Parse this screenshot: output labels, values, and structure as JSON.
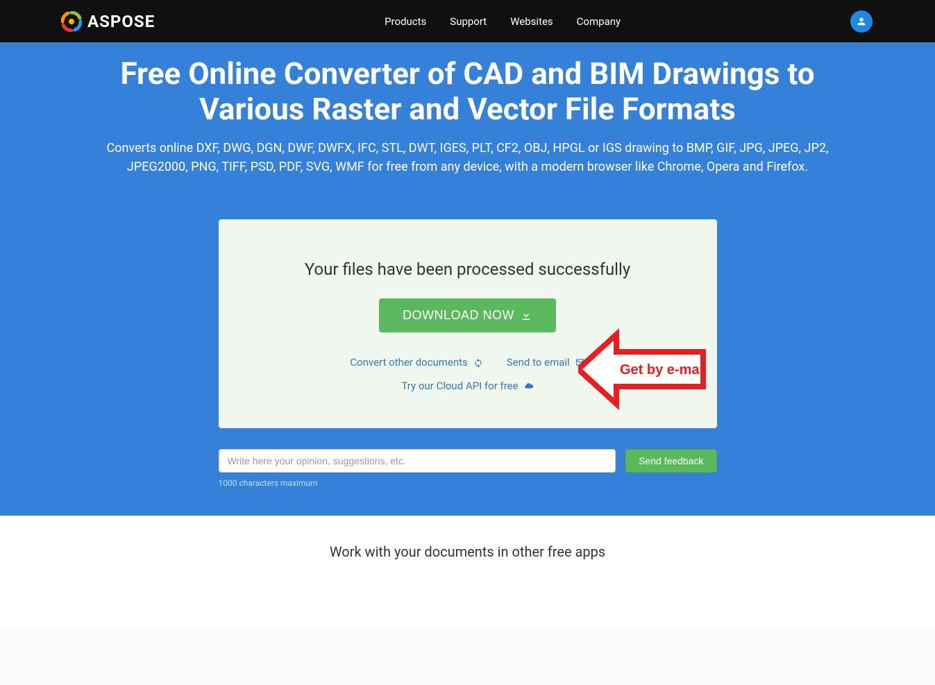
{
  "brand": "ASPOSE",
  "nav": {
    "products": "Products",
    "support": "Support",
    "websites": "Websites",
    "company": "Company"
  },
  "hero": {
    "title": "Free Online Converter of CAD and BIM Drawings to Various Raster and Vector File Formats",
    "subtitle": "Converts online DXF, DWG, DGN, DWF, DWFX, IFC, STL, DWT, IGES, PLT, CF2, OBJ, HPGL or IGS drawing to BMP, GIF, JPG, JPEG, JP2, JPEG2000, PNG, TIFF, PSD, PDF, SVG, WMF for free from any device, with a modern browser like Chrome, Opera and Firefox."
  },
  "card": {
    "success": "Your files have been processed successfully",
    "download": "DOWNLOAD NOW",
    "convert_other": "Convert other documents",
    "send_email": "Send to email",
    "cloud_api": "Try our Cloud API for free"
  },
  "annotation": {
    "text": "Get by e-mail"
  },
  "feedback": {
    "placeholder": "Write here your opinion, suggestions, etc.",
    "send": "Send feedback",
    "limit": "1000 characters maximum"
  },
  "bottom": {
    "heading": "Work with your documents in other free apps"
  }
}
